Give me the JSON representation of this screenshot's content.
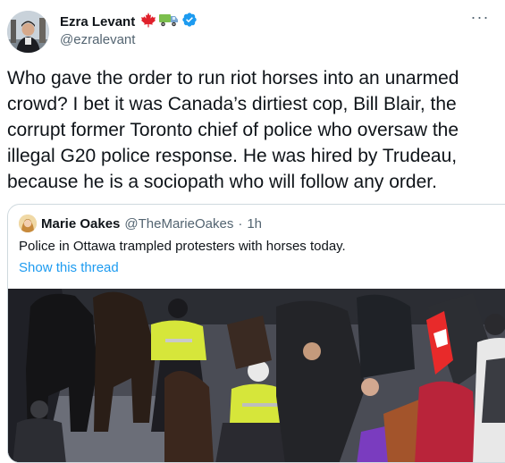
{
  "author": {
    "name": "Ezra Levant",
    "handle": "@ezralevant",
    "badges": [
      "maple-leaf-icon",
      "truck-icon",
      "verified-badge-icon"
    ]
  },
  "tweet": {
    "text": "Who gave the order to run riot horses into an unarmed\ncrowd? I bet it was Canada’s dirtiest cop, Bill Blair, the\ncorrupt former Toronto chief of police who oversaw the\nillegal G20 police response. He was hired by Trudeau,\nbecause he is a sociopath who will follow any order."
  },
  "quoted": {
    "name": "Marie Oakes",
    "handle": "@TheMarieOakes",
    "separator": "·",
    "time": "1h",
    "text": "Police in Ottawa trampled protesters with horses today.",
    "thread_link": "Show this thread"
  },
  "colors": {
    "link": "#1d9bf0",
    "secondary_text": "#536471",
    "border": "#cfd9de",
    "canada_red": "#e0202b",
    "verified_blue": "#1d9bf0"
  }
}
